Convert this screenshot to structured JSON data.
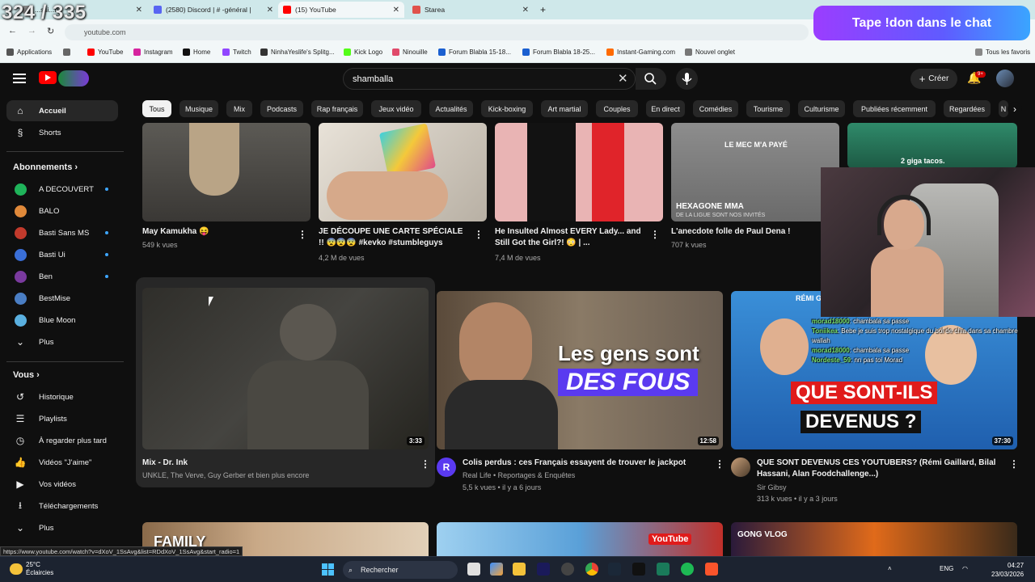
{
  "overlay": {
    "counter": "324 / 335",
    "banner": "Tape !don dans le chat"
  },
  "browser": {
    "tabs": [
      {
        "title": "...ssi...ns",
        "color": "#888888",
        "active": false
      },
      {
        "title": "(2580) Discord | # -général |",
        "color": "#5865f2",
        "active": false
      },
      {
        "title": "(15) YouTube",
        "color": "#ff0000",
        "active": true
      },
      {
        "title": "Starea",
        "color": "#e0524b",
        "active": false
      }
    ],
    "url": "youtube.com",
    "bookmarks": [
      {
        "label": "Applications",
        "color": "#555555"
      },
      {
        "label": "YouTube",
        "color": "#ff0000"
      },
      {
        "label": "Instagram",
        "color": "#d6249f"
      },
      {
        "label": "Home",
        "color": "#111111"
      },
      {
        "label": "Twitch",
        "color": "#9146ff"
      },
      {
        "label": "NinhaYeslife's Splitg...",
        "color": "#333333"
      },
      {
        "label": "Kick Logo",
        "color": "#53fc18"
      },
      {
        "label": "Ninouille",
        "color": "#e04a6a"
      },
      {
        "label": "Forum Blabla 15-18...",
        "color": "#1a5fd0"
      },
      {
        "label": "Forum Blabla 18-25...",
        "color": "#1a5fd0"
      },
      {
        "label": "Instant-Gaming.com",
        "color": "#ff6a00"
      },
      {
        "label": "Nouvel onglet",
        "color": "#777777"
      }
    ],
    "all_bookmarks": "Tous les favoris"
  },
  "youtube": {
    "search_value": "shamballa",
    "create_label": "Créer",
    "notif_count": "9+",
    "chips": [
      "Tous",
      "Musique",
      "Mix",
      "Podcasts",
      "Rap français",
      "Jeux vidéo",
      "Actualités",
      "Kick-boxing",
      "Art martial",
      "Couples",
      "En direct",
      "Comédies",
      "Tourisme",
      "Culturisme",
      "Publiées récemment",
      "Regardées",
      "N"
    ],
    "sidebar": {
      "home": "Accueil",
      "shorts": "Shorts",
      "subs_heading": "Abonnements",
      "subs": [
        {
          "name": "A DECOUVERT",
          "color": "#1fb35a"
        },
        {
          "name": "BALO",
          "color": "#e0893a"
        },
        {
          "name": "Basti Sans MS",
          "color": "#c23a2c"
        },
        {
          "name": "Basti Ui",
          "color": "#3a6fd8"
        },
        {
          "name": "Ben",
          "color": "#7a3a9e"
        },
        {
          "name": "BestMise",
          "color": "#4a7ec4"
        },
        {
          "name": "Blue Moon",
          "color": "#5ab0e0"
        }
      ],
      "subs_more": "Plus",
      "you_heading": "Vous",
      "you_items": [
        "Historique",
        "Playlists",
        "À regarder plus tard",
        "Vidéos \"J'aime\"",
        "Vos vidéos",
        "Téléchargements",
        "Plus"
      ]
    },
    "row1": [
      {
        "title": "May Kamukha 😝",
        "meta": "549 k vues",
        "meta2": "",
        "overlay": ""
      },
      {
        "title": "JE DÉCOUPE UNE CARTE SPÉCIALE !! 😨😨😨 #kevko #stumbleguys",
        "meta": "4,2 M de vues",
        "meta2": "",
        "overlay": ""
      },
      {
        "title": "He Insulted Almost EVERY Lady... and Still Got the Girl?! 😳 | ...",
        "meta": "7,4 M de vues",
        "meta2": "",
        "overlay": ""
      },
      {
        "title": "L'anecdote folle de Paul Dena !",
        "meta": "707 k vues",
        "meta2": "",
        "overlay": "LE MEC M'A PAYÉ",
        "overlay2": "HEXAGONE MMA",
        "overlay3": "DE LA LIGUE SONT NOS INVITÉS"
      },
      {
        "title": "",
        "meta": "",
        "meta2": "",
        "overlay": "2 giga tacos."
      }
    ],
    "row2": [
      {
        "title": "Mix - Dr. Ink",
        "channel": "UNKLE, The Verve, Guy Gerber et bien plus encore",
        "stats": "",
        "duration": "3:33"
      },
      {
        "title": "Colis perdus : ces Français essayent de trouver le jackpot",
        "channel": "Real Life • Reportages & Enquêtes",
        "stats": "5,5 k vues • il y a 6 jours",
        "duration": "12:58",
        "thumb_text1": "Les gens sont",
        "thumb_text2": "DES FOUS",
        "avatar_letter": "R"
      },
      {
        "title": "QUE SONT DEVENUS CES YOUTUBERS? (Rémi Gaillard, Bilal Hassani, Alan Foodchallenge...)",
        "channel": "Sir Gibsy",
        "stats": "313 k vues • il y a 3 jours",
        "duration": "37:30",
        "thumb_text1": "QUE SONT-ILS",
        "thumb_text2": "DEVENUS ?",
        "thumb_text3": "RÉMI GAILLARD",
        "thumb_text4": "BILAL HASSANI"
      }
    ],
    "row3": [
      {
        "overlay": "FAMILY"
      },
      {
        "overlay": ""
      },
      {
        "overlay": "YouTube"
      },
      {
        "overlay": "GONG VLOG"
      }
    ]
  },
  "chat": [
    {
      "user": "morad18000",
      "text": ": chambala sa passe"
    },
    {
      "user": "Toniikea",
      "text": ": Bebe je suis trop nostalgique du bol de chia dans sa chambre wallah"
    },
    {
      "user": "morad18000",
      "text": ": chambala sa passe"
    },
    {
      "user": "Nordeste_59",
      "text": ": nn pas toi Morad"
    }
  ],
  "status_url": "https://www.youtube.com/watch?v=dXoV_1SsAvg&list=RDdXoV_1SsAvg&start_radio=1",
  "taskbar": {
    "temp": "25°C",
    "weather": "Éclaircies",
    "search": "Rechercher",
    "lang": "ENG",
    "time": "04:27",
    "date": "23/03/2026"
  }
}
